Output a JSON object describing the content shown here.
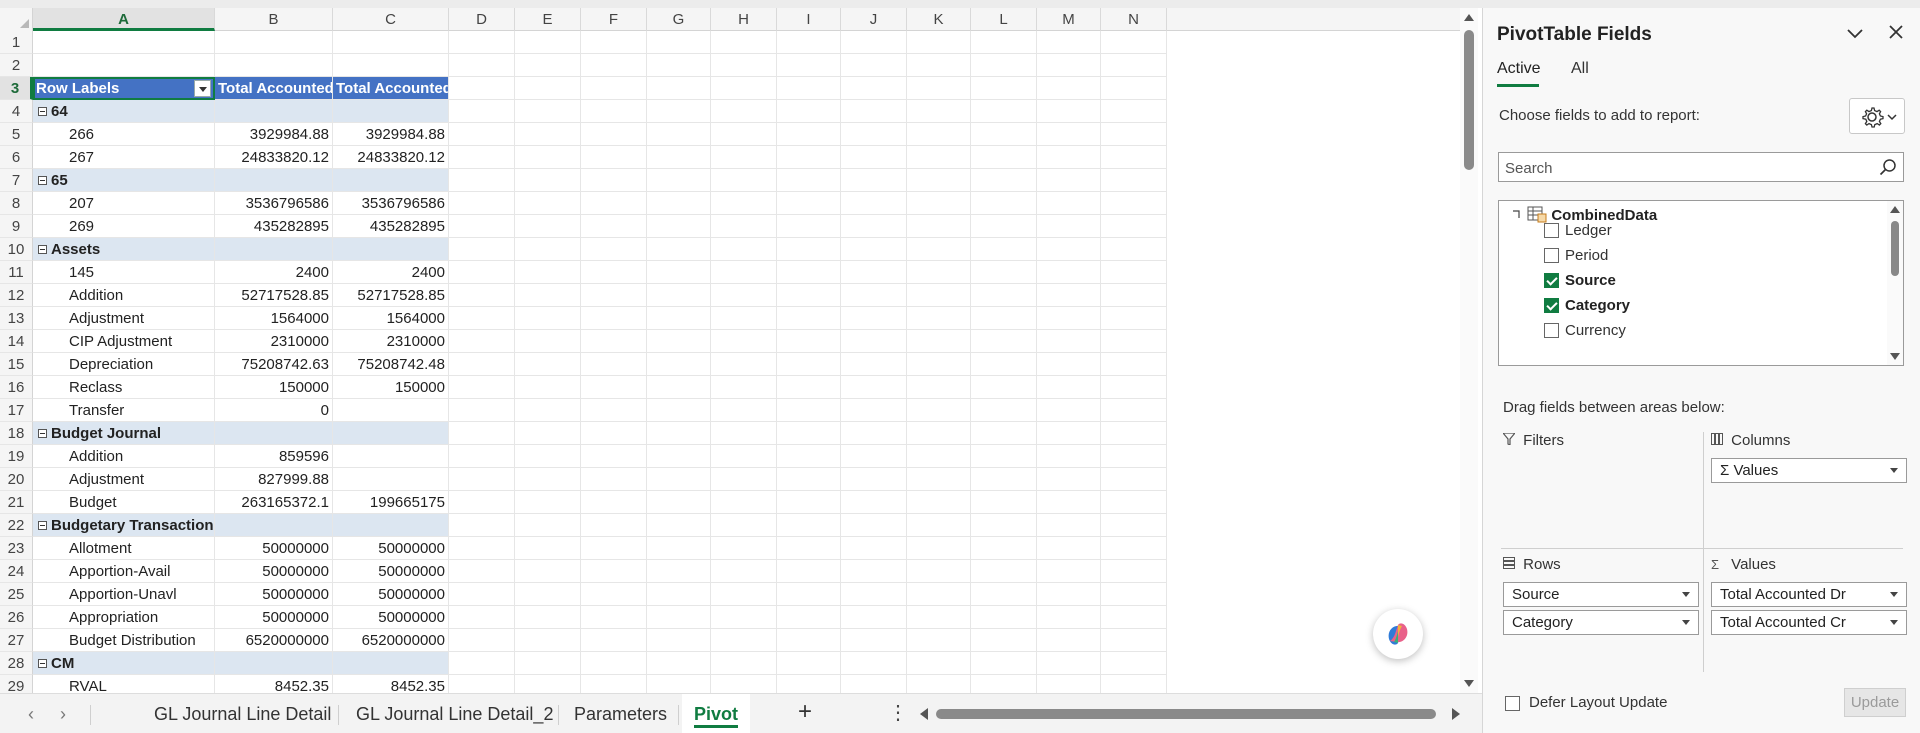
{
  "colors": {
    "accent": "#107c41",
    "pivot_header_bg": "#4472c4",
    "pivot_group_bg": "#dce6f1"
  },
  "grid": {
    "columns": [
      "A",
      "B",
      "C",
      "D",
      "E",
      "F",
      "G",
      "H",
      "I",
      "J",
      "K",
      "L",
      "M",
      "N"
    ],
    "header": {
      "row_labels": "Row Labels",
      "total_dr": "Total Accounted Dr",
      "total_cr": "Total Accounted Cr"
    },
    "rows": [
      {
        "n": "1",
        "type": "empty"
      },
      {
        "n": "2",
        "type": "empty"
      },
      {
        "n": "3",
        "type": "header"
      },
      {
        "n": "4",
        "type": "group",
        "label": "64"
      },
      {
        "n": "5",
        "type": "item",
        "label": "266",
        "dr": "3929984.88",
        "cr": "3929984.88"
      },
      {
        "n": "6",
        "type": "item",
        "label": "267",
        "dr": "24833820.12",
        "cr": "24833820.12"
      },
      {
        "n": "7",
        "type": "group",
        "label": "65"
      },
      {
        "n": "8",
        "type": "item",
        "label": "207",
        "dr": "3536796586",
        "cr": "3536796586"
      },
      {
        "n": "9",
        "type": "item",
        "label": "269",
        "dr": "435282895",
        "cr": "435282895"
      },
      {
        "n": "10",
        "type": "group",
        "label": "Assets"
      },
      {
        "n": "11",
        "type": "item",
        "label": "145",
        "dr": "2400",
        "cr": "2400"
      },
      {
        "n": "12",
        "type": "item",
        "label": "Addition",
        "dr": "52717528.85",
        "cr": "52717528.85"
      },
      {
        "n": "13",
        "type": "item",
        "label": "Adjustment",
        "dr": "1564000",
        "cr": "1564000"
      },
      {
        "n": "14",
        "type": "item",
        "label": "CIP Adjustment",
        "dr": "2310000",
        "cr": "2310000"
      },
      {
        "n": "15",
        "type": "item",
        "label": "Depreciation",
        "dr": "75208742.63",
        "cr": "75208742.48"
      },
      {
        "n": "16",
        "type": "item",
        "label": "Reclass",
        "dr": "150000",
        "cr": "150000"
      },
      {
        "n": "17",
        "type": "item",
        "label": "Transfer",
        "dr": "0",
        "cr": ""
      },
      {
        "n": "18",
        "type": "group",
        "label": "Budget Journal"
      },
      {
        "n": "19",
        "type": "item",
        "label": "Addition",
        "dr": "859596",
        "cr": ""
      },
      {
        "n": "20",
        "type": "item",
        "label": "Adjustment",
        "dr": "827999.88",
        "cr": ""
      },
      {
        "n": "21",
        "type": "item",
        "label": "Budget",
        "dr": "263165372.1",
        "cr": "199665175"
      },
      {
        "n": "22",
        "type": "group",
        "label": "Budgetary Transaction"
      },
      {
        "n": "23",
        "type": "item",
        "label": "Allotment",
        "dr": "50000000",
        "cr": "50000000"
      },
      {
        "n": "24",
        "type": "item",
        "label": "Apportion-Avail",
        "dr": "50000000",
        "cr": "50000000"
      },
      {
        "n": "25",
        "type": "item",
        "label": "Apportion-Unavl",
        "dr": "50000000",
        "cr": "50000000"
      },
      {
        "n": "26",
        "type": "item",
        "label": "Appropriation",
        "dr": "50000000",
        "cr": "50000000"
      },
      {
        "n": "27",
        "type": "item",
        "label": "Budget Distribution",
        "dr": "6520000000",
        "cr": "6520000000"
      },
      {
        "n": "28",
        "type": "group",
        "label": "CM"
      },
      {
        "n": "29",
        "type": "item",
        "label": "RVAL",
        "dr": "8452.35",
        "cr": "8452.35"
      }
    ]
  },
  "sheet_tabs": [
    "GL Journal Line Detail",
    "GL Journal Line Detail_2",
    "Parameters",
    "Pivot"
  ],
  "active_sheet": "Pivot",
  "tabbar": {
    "add": "+",
    "more": "⋮",
    "prev": "‹",
    "next": "›"
  },
  "pivot_pane": {
    "title": "PivotTable Fields",
    "tab_active": "Active",
    "tab_all": "All",
    "choose_label": "Choose fields to add to report:",
    "search_placeholder": "Search",
    "table_name": "CombinedData",
    "fields": [
      {
        "label": "Ledger",
        "checked": false
      },
      {
        "label": "Period",
        "checked": false
      },
      {
        "label": "Source",
        "checked": true
      },
      {
        "label": "Category",
        "checked": true
      },
      {
        "label": "Currency",
        "checked": false
      }
    ],
    "drag_label": "Drag fields between areas below:",
    "areas": {
      "filters": {
        "title": "Filters",
        "items": []
      },
      "columns": {
        "title": "Columns",
        "items": [
          "Σ Values"
        ]
      },
      "rows": {
        "title": "Rows",
        "items": [
          "Source",
          "Category"
        ]
      },
      "values": {
        "title": "Values",
        "items": [
          "Total Accounted Dr",
          "Total Accounted Cr"
        ]
      }
    },
    "defer_label": "Defer Layout Update",
    "update_label": "Update"
  }
}
